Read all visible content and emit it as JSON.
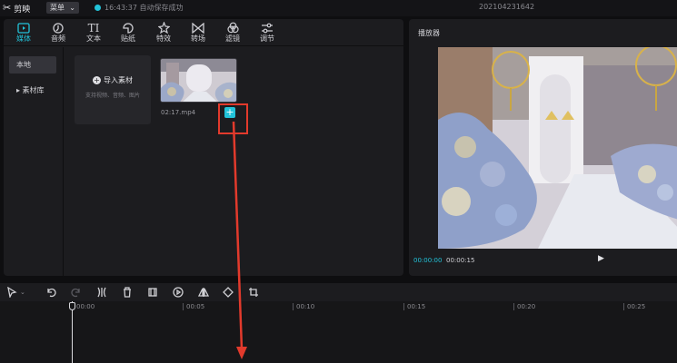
{
  "app": {
    "logo_text": "剪映",
    "menu_label": "菜单",
    "save_status": "16:43:37 自动保存成功",
    "project_name": "202104231642"
  },
  "media_toolbar": {
    "items": [
      {
        "label": "媒体",
        "icon": "media-icon",
        "active": true
      },
      {
        "label": "音频",
        "icon": "audio-icon"
      },
      {
        "label": "文本",
        "icon": "text-icon"
      },
      {
        "label": "贴纸",
        "icon": "sticker-icon"
      },
      {
        "label": "特效",
        "icon": "effects-icon"
      },
      {
        "label": "转场",
        "icon": "transition-icon"
      },
      {
        "label": "滤镜",
        "icon": "filter-icon"
      },
      {
        "label": "调节",
        "icon": "adjust-icon"
      }
    ]
  },
  "sidebar": {
    "items": [
      {
        "label": "本地",
        "selected": true
      },
      {
        "label": "▸ 素材库"
      }
    ]
  },
  "import": {
    "title": "导入素材",
    "subtitle": "支持视频、音频、图片"
  },
  "clip": {
    "duration_label": "02:17.mp4"
  },
  "player": {
    "title": "播放器",
    "current_time": "00:00:00",
    "total_time": "00:00:15"
  },
  "timeline": {
    "ticks": [
      "00:00",
      "00:05",
      "00:10",
      "00:15",
      "00:20",
      "00:25"
    ]
  },
  "colors": {
    "accent": "#22c3d9",
    "annotation": "#e23a2c",
    "panel": "#1c1c1f"
  }
}
